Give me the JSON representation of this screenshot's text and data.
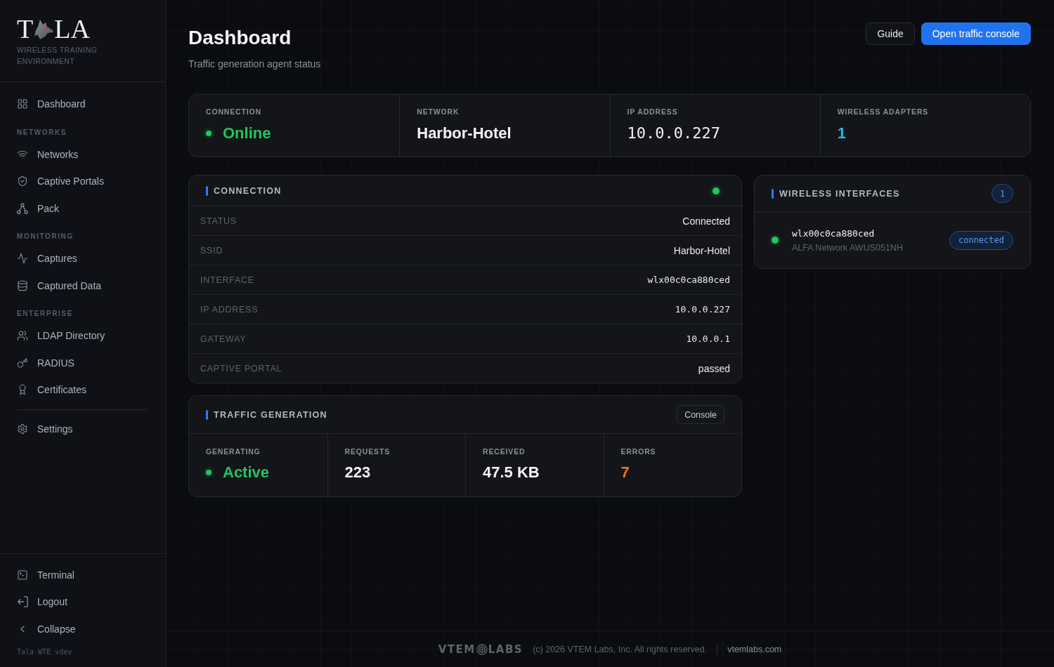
{
  "sidebar": {
    "logo": {
      "text_start": "T",
      "text_end": "LA",
      "tagline": "WIRELESS TRAINING ENVIRONMENT"
    },
    "nav_groups": [
      {
        "items": [
          {
            "label": "Dashboard"
          }
        ]
      },
      {
        "title": "NETWORKS",
        "items": [
          {
            "label": "Networks"
          },
          {
            "label": "Captive Portals"
          },
          {
            "label": "Pack"
          }
        ]
      },
      {
        "title": "MONITORING",
        "items": [
          {
            "label": "Captures"
          },
          {
            "label": "Captured Data"
          }
        ]
      },
      {
        "title": "ENTERPRISE",
        "items": [
          {
            "label": "LDAP Directory"
          },
          {
            "label": "RADIUS"
          },
          {
            "label": "Certificates"
          }
        ]
      }
    ],
    "settings": {
      "label": "Settings"
    },
    "bottom_items": [
      {
        "label": "Terminal"
      },
      {
        "label": "Logout"
      },
      {
        "label": "Collapse"
      }
    ],
    "version": "Tala WTE vdev"
  },
  "header": {
    "title": "Dashboard",
    "subtitle": "Traffic generation agent status",
    "buttons": [
      {
        "label": "Guide",
        "kind": "secondary"
      },
      {
        "label": "Open traffic console",
        "kind": "primary"
      }
    ]
  },
  "summary": [
    {
      "label": "CONNECTION",
      "value": "Online",
      "kind": "status"
    },
    {
      "label": "NETWORK",
      "value": "Harbor-Hotel",
      "kind": "text"
    },
    {
      "label": "IP ADDRESS",
      "value": "10.0.0.227",
      "kind": "mono"
    },
    {
      "label": "WIRELESS ADAPTERS",
      "value": "1",
      "kind": "count"
    }
  ],
  "connection_panel": {
    "title": "CONNECTION",
    "online": true,
    "rows": [
      {
        "label": "STATUS",
        "value": "Connected",
        "kind": "text"
      },
      {
        "label": "SSID",
        "value": "Harbor-Hotel",
        "kind": "text"
      },
      {
        "label": "INTERFACE",
        "value": "wlx00c0ca880ced",
        "kind": "mono"
      },
      {
        "label": "IP ADDRESS",
        "value": "10.0.0.227",
        "kind": "mono"
      },
      {
        "label": "GATEWAY",
        "value": "10.0.0.1",
        "kind": "mono"
      },
      {
        "label": "CAPTIVE PORTAL",
        "value": "passed",
        "kind": "text"
      }
    ]
  },
  "traffic_panel": {
    "title": "TRAFFIC GENERATION",
    "button": "Console",
    "stats": [
      {
        "label": "GENERATING",
        "value": "Active",
        "kind": "status"
      },
      {
        "label": "REQUESTS",
        "value": "223",
        "kind": "text"
      },
      {
        "label": "RECEIVED",
        "value": "47.5 KB",
        "kind": "text"
      },
      {
        "label": "ERRORS",
        "value": "7",
        "kind": "warning"
      }
    ]
  },
  "interfaces_panel": {
    "title": "WIRELESS INTERFACES",
    "count": "1",
    "interfaces": [
      {
        "name": "wlx00c0ca880ced",
        "model": "ALFA Network AWUS051NH",
        "status": "connected",
        "online": true
      }
    ]
  },
  "footer": {
    "brand_start": "VTEM",
    "brand_end": "LABS",
    "copyright": "(c) 2026 VTEM Labs, Inc. All rights reserved.",
    "link": "vtemlabs.com"
  }
}
